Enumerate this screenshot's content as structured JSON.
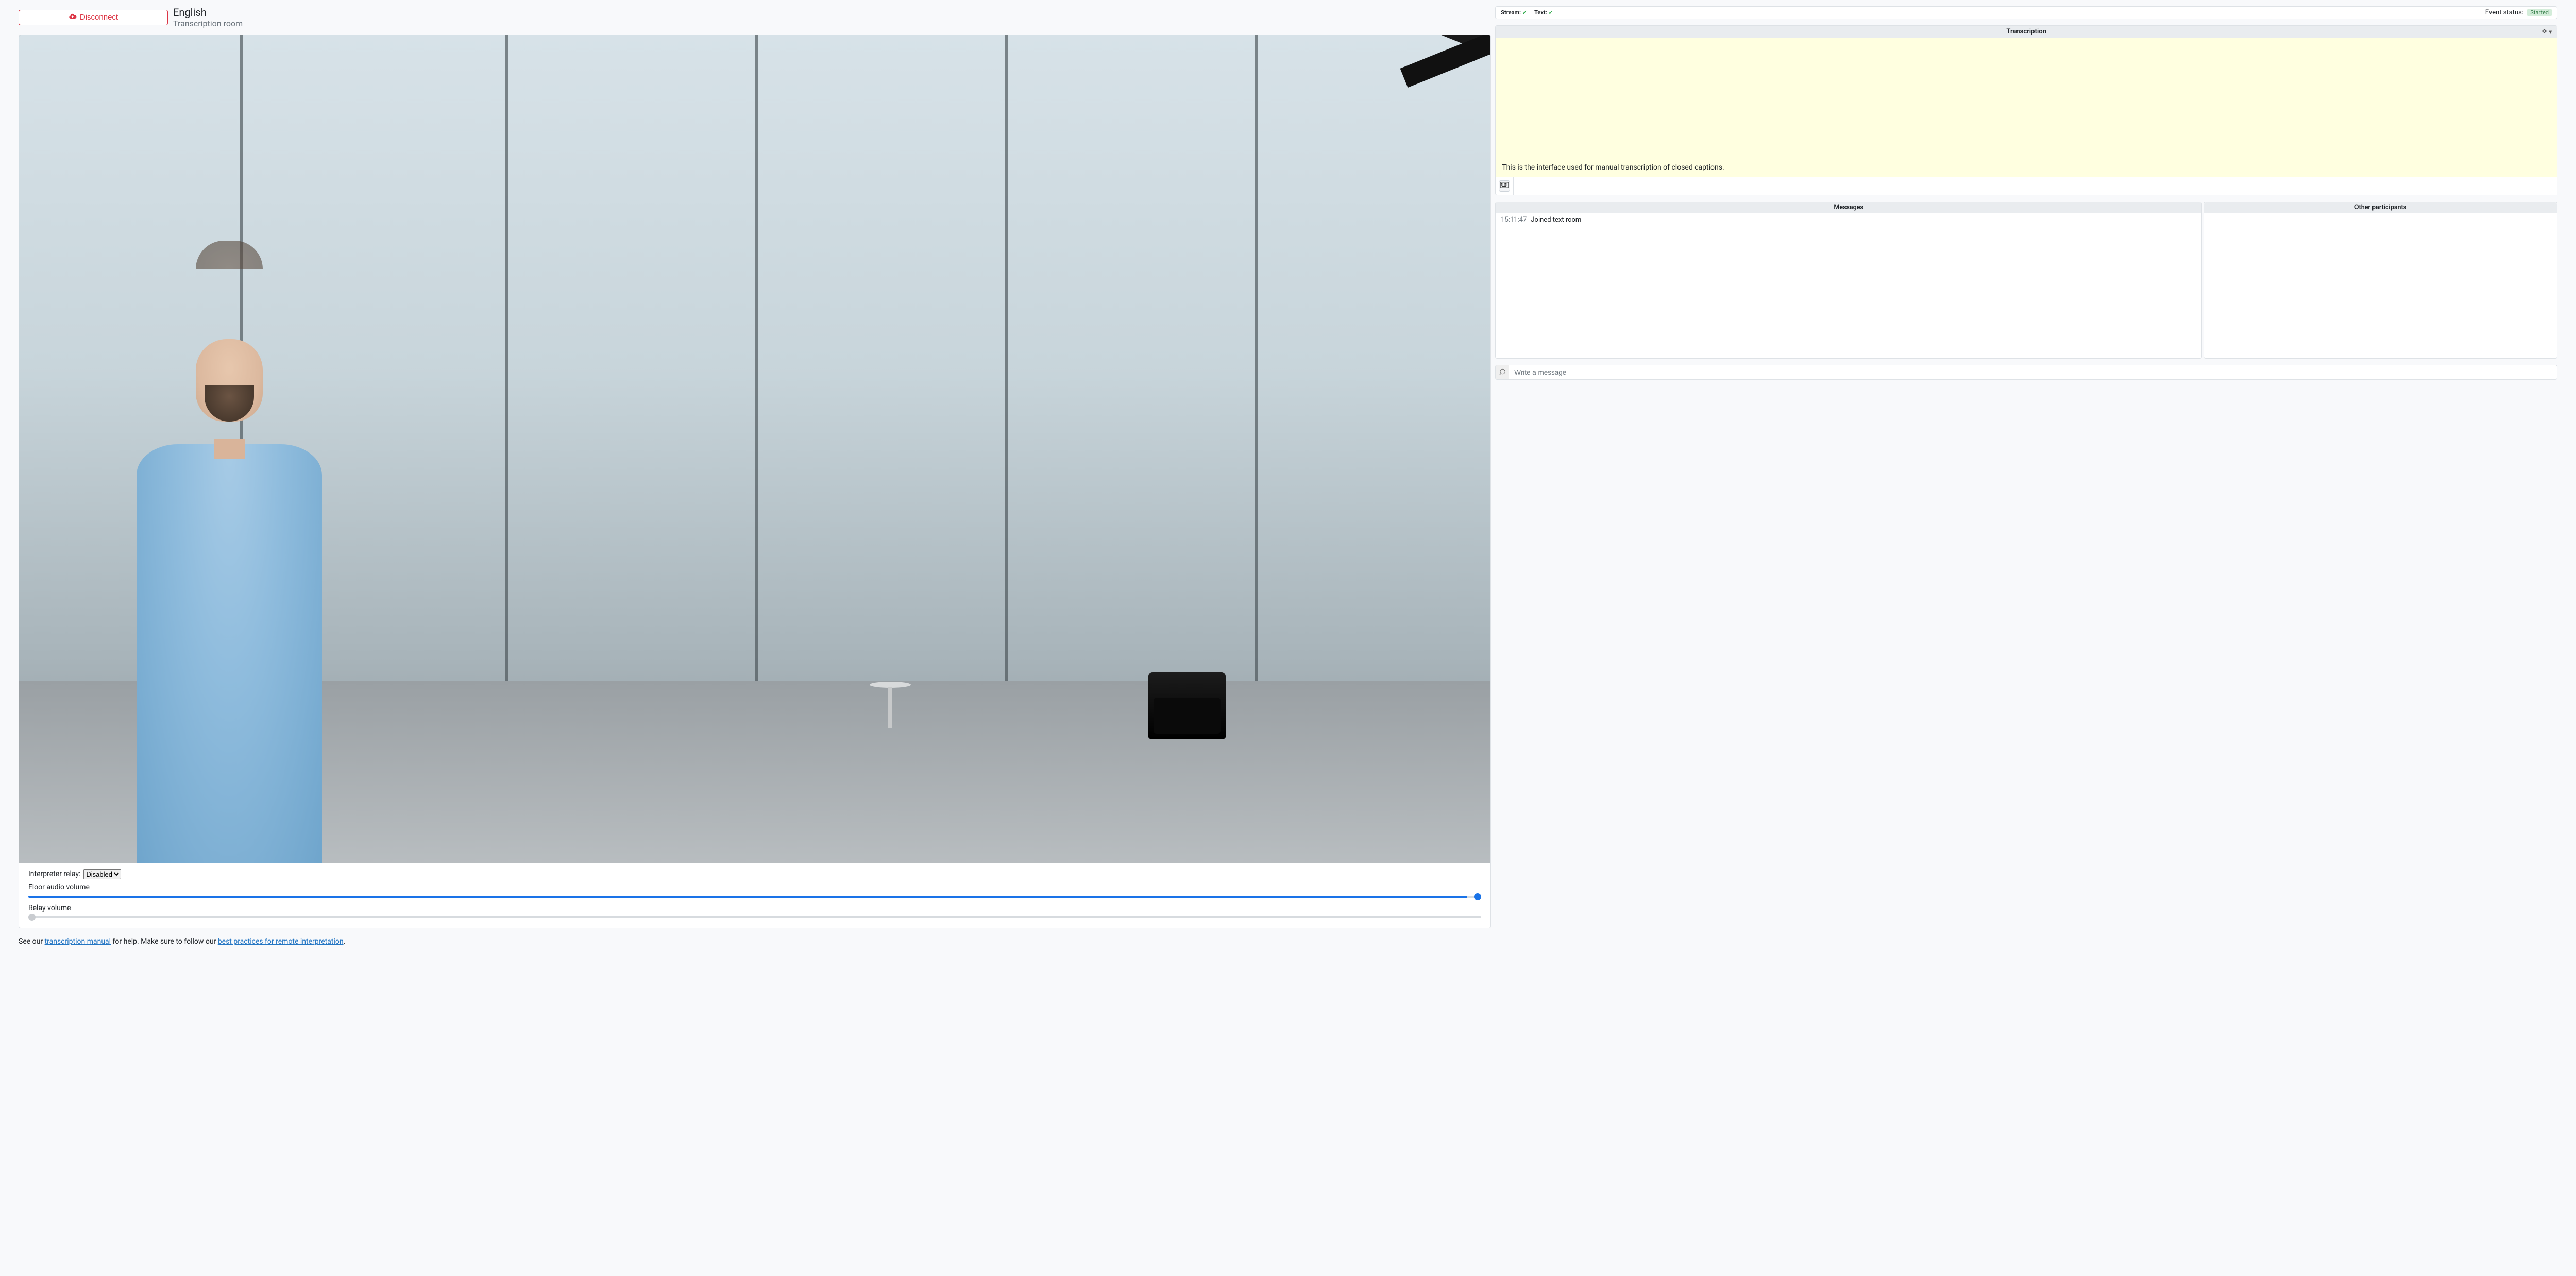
{
  "header": {
    "disconnect_label": "Disconnect",
    "title": "English",
    "subtitle": "Transcription room"
  },
  "controls": {
    "relay_label": "Interpreter relay:",
    "relay_value": "Disabled",
    "relay_options": [
      "Disabled"
    ],
    "floor_volume_label": "Floor audio volume",
    "floor_volume_value": 100,
    "relay_volume_label": "Relay volume",
    "relay_volume_value": 0
  },
  "help": {
    "prefix": "See our ",
    "link1": "transcription manual",
    "mid": " for help. Make sure to follow our ",
    "link2": "best practices for remote interpretation",
    "suffix": "."
  },
  "status": {
    "stream_label": "Stream:",
    "text_label": "Text:",
    "event_status_label": "Event status:",
    "event_status_value": "Started"
  },
  "transcription": {
    "header": "Transcription",
    "body_text": "This is the interface used for manual transcription of closed captions.",
    "input_value": ""
  },
  "messages": {
    "header": "Messages",
    "entries": [
      {
        "ts": "15:11:47",
        "text": "Joined text room"
      }
    ]
  },
  "participants": {
    "header": "Other participants"
  },
  "compose": {
    "placeholder": "Write a message"
  }
}
